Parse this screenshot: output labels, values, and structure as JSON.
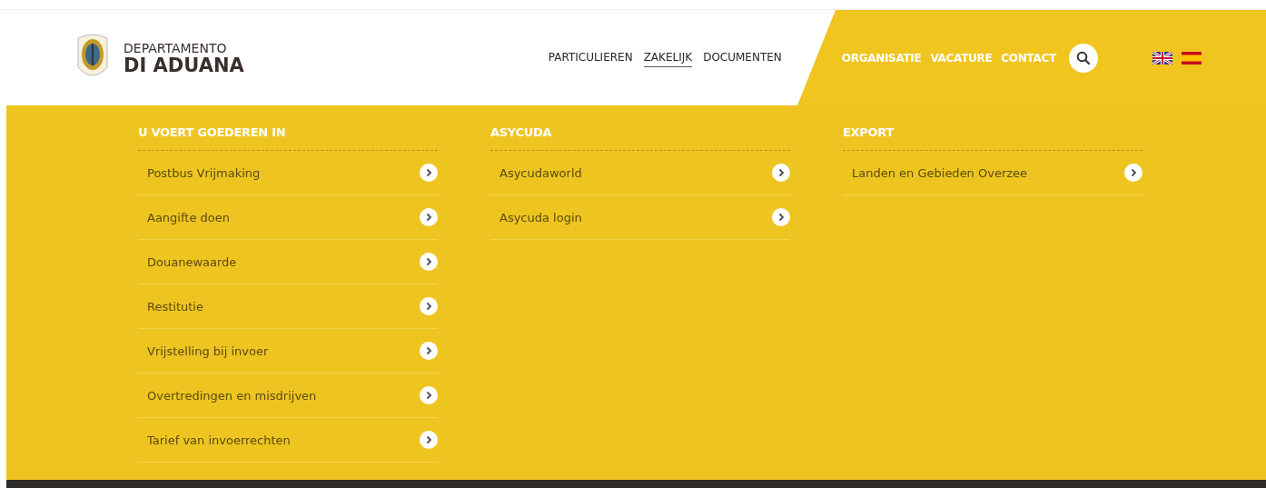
{
  "logo": {
    "line1": "DEPARTAMENTO",
    "line2": "DI ADUANA"
  },
  "main_nav": [
    {
      "label": "PARTICULIEREN",
      "selected": false
    },
    {
      "label": "ZAKELIJK",
      "selected": true
    },
    {
      "label": "DOCUMENTEN",
      "selected": false
    }
  ],
  "secondary_nav": [
    {
      "label": "ORGANISATIE"
    },
    {
      "label": "VACATURE"
    },
    {
      "label": "CONTACT"
    }
  ],
  "menu_columns": [
    {
      "heading": "U VOERT GOEDEREN IN",
      "items": [
        "Postbus Vrijmaking",
        "Aangifte doen",
        "Douanewaarde",
        "Restitutie",
        "Vrijstelling bij invoer",
        "Overtredingen en misdrijven",
        "Tarief van invoerrechten"
      ]
    },
    {
      "heading": "ASYCUDA",
      "items": [
        "Asycudaworld",
        "Asycuda login"
      ]
    },
    {
      "heading": "EXPORT",
      "items": [
        "Landen en Gebieden Overzee"
      ]
    }
  ]
}
